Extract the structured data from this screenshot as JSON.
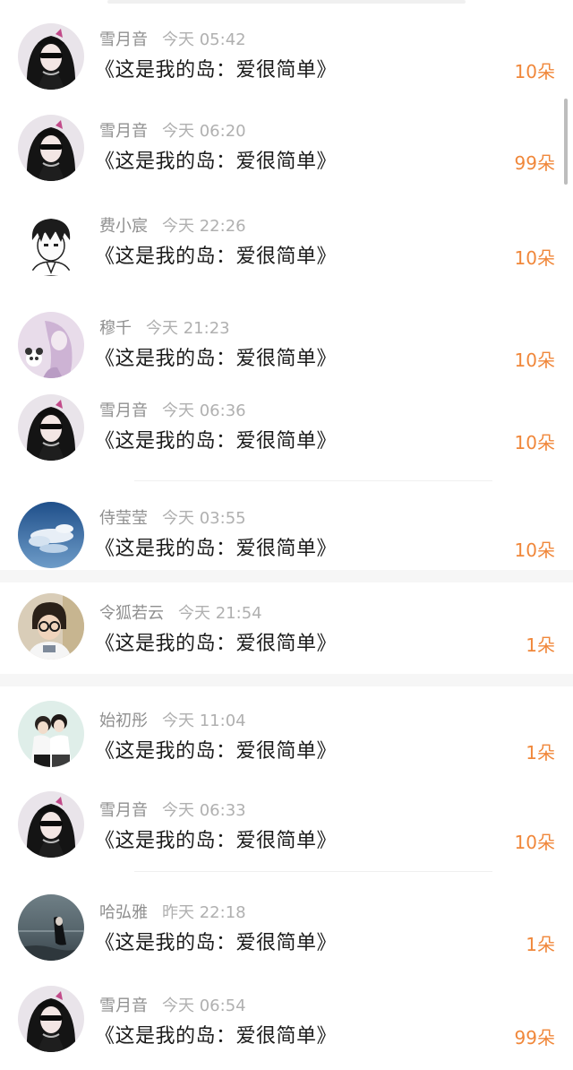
{
  "rows": [
    {
      "avatar": "girl-sunglasses-avatar",
      "name": "雪月音",
      "time": "今天 05:42",
      "title": "《这是我的岛：爱很简单》",
      "count": "10朵"
    },
    {
      "avatar": "girl-sunglasses-avatar",
      "name": "雪月音",
      "time": "今天 06:20",
      "title": "《这是我的岛：爱很简单》",
      "count": "99朵"
    },
    {
      "avatar": "anime-boy-avatar",
      "name": "费小宸",
      "time": "今天 22:26",
      "title": "《这是我的岛：爱很简单》",
      "count": "10朵"
    },
    {
      "avatar": "pastel-girl-panda-avatar",
      "name": "穆千",
      "time": "今天 21:23",
      "title": "《这是我的岛：爱很简单》",
      "count": "10朵"
    },
    {
      "avatar": "girl-sunglasses-avatar",
      "name": "雪月音",
      "time": "今天 06:36",
      "title": "《这是我的岛：爱很简单》",
      "count": "10朵"
    },
    {
      "avatar": "sky-clouds-avatar",
      "name": "侍莹莹",
      "time": "今天 03:55",
      "title": "《这是我的岛：爱很简单》",
      "count": "10朵"
    },
    {
      "avatar": "boy-glasses-photo-avatar",
      "name": "令狐若云",
      "time": "今天 21:54",
      "title": "《这是我的岛：爱很简单》",
      "count": "1朵"
    },
    {
      "avatar": "two-girls-photo-avatar",
      "name": "始初彤",
      "time": "今天 11:04",
      "title": "《这是我的岛：爱很简单》",
      "count": "1朵"
    },
    {
      "avatar": "girl-sunglasses-avatar",
      "name": "雪月音",
      "time": "今天 06:33",
      "title": "《这是我的岛：爱很简单》",
      "count": "10朵"
    },
    {
      "avatar": "girl-by-sea-avatar",
      "name": "哈弘雅",
      "time": "昨天 22:18",
      "title": "《这是我的岛：爱很简单》",
      "count": "1朵"
    },
    {
      "avatar": "girl-sunglasses-avatar",
      "name": "雪月音",
      "time": "今天 06:54",
      "title": "《这是我的岛：爱很简单》",
      "count": "99朵"
    }
  ],
  "colors": {
    "accent": "#f0873a",
    "name": "#8f8f8f",
    "title": "#1a1a1a"
  }
}
